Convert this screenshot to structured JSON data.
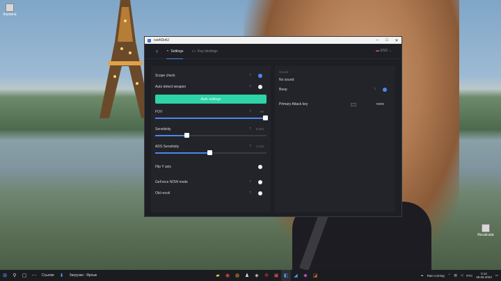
{
  "desktop": {
    "icons": [
      {
        "label": "Корзина"
      },
      {
        "label": "Recalculat"
      }
    ]
  },
  "window": {
    "title": "csehDotU",
    "tabs": [
      {
        "label": "Settings",
        "icon": "headset-icon",
        "active": true
      },
      {
        "label": "Key bindings",
        "icon": "keyboard-icon",
        "active": false
      }
    ],
    "language": "ENG",
    "left": {
      "scope_check": {
        "label": "Scope check",
        "on": true
      },
      "auto_detect": {
        "label": "Auto detect weapon",
        "on": false
      },
      "auto_button": "Auto settings",
      "sliders": [
        {
          "label": "FOV",
          "value": "90",
          "fraction": 0.99
        },
        {
          "label": "Sensitivity",
          "value": "0.600",
          "fraction": 0.28
        },
        {
          "label": "ADS Sensitivity",
          "value": "1.010",
          "fraction": 0.49
        }
      ],
      "toggles": [
        {
          "label": "Flip Y axis",
          "on": false
        },
        {
          "label": "GeForce NOW mode",
          "on": false
        },
        {
          "label": "Old recoil",
          "on": false
        }
      ]
    },
    "right": {
      "section_label": "Sound",
      "no_sound": "No sound",
      "beep": {
        "label": "Beep",
        "on": true
      },
      "primary_key": {
        "label": "Primary Attack key",
        "value": "none"
      }
    }
  },
  "taskbar": {
    "search_text": "Ссылки",
    "download_text": "Загрузки - Ярлык",
    "weather": "Rain coming",
    "lang": "РУС",
    "time": "0:12",
    "date": "28.06.2023"
  },
  "colors": {
    "accent": "#4d86f0",
    "button": "#2ed3a8"
  }
}
